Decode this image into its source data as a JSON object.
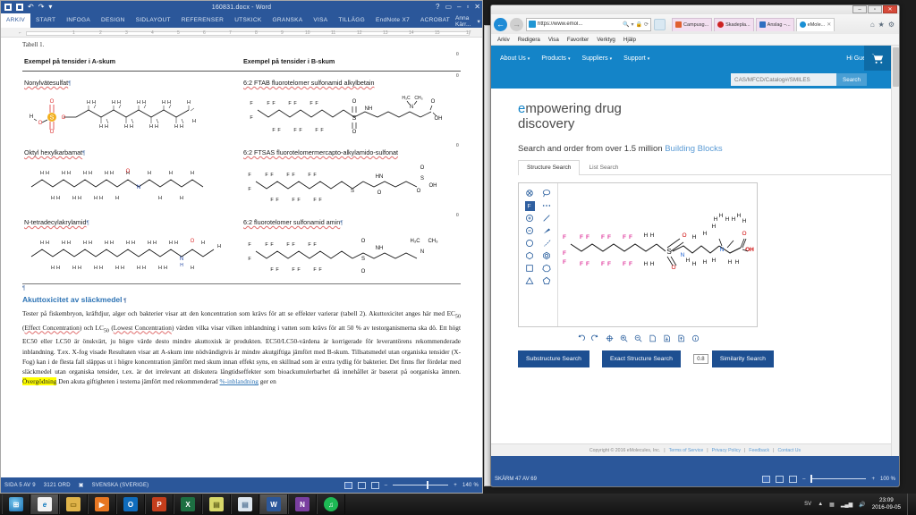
{
  "word": {
    "title": "160831.docx - Word",
    "qat": {
      "save": "save-icon",
      "undo": "↶",
      "redo": "↷",
      "more": "▾"
    },
    "window_controls": {
      "help": "?",
      "ribbon": "▭",
      "minimize": "–",
      "maximize": "▫",
      "close": "✕"
    },
    "tabs": [
      "ARKIV",
      "START",
      "INFOGA",
      "DESIGN",
      "SIDLAYOUT",
      "REFERENSER",
      "UTSKICK",
      "GRANSKA",
      "VISA",
      "TILLÄGG",
      "EndNote X7",
      "ACROBAT"
    ],
    "user": "Anna Kärr...",
    "ruler_marks": [
      "1",
      "2",
      "3",
      "4",
      "5",
      "6",
      "7",
      "8",
      "9",
      "10",
      "11",
      "12",
      "13",
      "14",
      "15",
      "17"
    ],
    "document": {
      "caption": "Tabell 1.",
      "table": {
        "headers": [
          "Exempel på tensider i A-skum",
          "Exempel på tensider i B-skum"
        ],
        "rows": [
          {
            "left": "Nonylvätesulfat",
            "right": "6:2 FTAB fluorotelomer sulfonamid alkylbetain"
          },
          {
            "left": "Oktyl hexylkarbamat",
            "right": "6:2 FTSAS fluorotelomermercapto-alkylamido-sulfonat"
          },
          {
            "left": "N-tetradecylakrylamid",
            "right": "6:2 fluorotelomer sulfonamid amin"
          }
        ]
      },
      "heading": "Akuttoxicitet av släckmedel",
      "body_parts": [
        {
          "t": "Tester på fiskembryon, kräftdjur, alger och bakterier visar att den koncentration som krävs för att se effekter varierar (tabell 2). Akuttoxicitet anges här med EC"
        },
        {
          "t": "50",
          "s": "sub"
        },
        {
          "t": " (",
          "s": "plain"
        },
        {
          "t": "Effect Concentration",
          "s": "sp"
        },
        {
          "t": ") och LC",
          "s": "plain"
        },
        {
          "t": "50",
          "s": "sub"
        },
        {
          "t": " (",
          "s": "plain"
        },
        {
          "t": "Lowest Concentration",
          "s": "sp"
        },
        {
          "t": ") värden vilka visar vilken inblandning i vatten som krävs för att 50 % av testorganismerna ska dö. Ett högt EC50 eller LC50 är önskvärt, ju högre värde desto mindre akuttoxisk är produkten. EC50/LC50-värdena är korrigerade för leverantörens rekommenderade inblandning. T.ex. X-fog visade Resultaten visar att A-skum inte nödvändigtvis är mindre akutgiftiga jämfört med B-skum. Tillsatsmedel utan organiska tensider (X-Fog) kan i de flesta fall släppas ut i högre koncentration jämfört med skum innan effekt syns, en skillnad som är extra tydlig för bakterier. Det finns fler fördelar med släckmedel utan organiska tensider, t.ex. är det irrelevant att diskutera långtidseffekter som bioackumulerbarhet då innehållet är baserat på oorganiska ämnen. ",
          "s": "plain"
        },
        {
          "t": "Övergödning",
          "s": "hl"
        },
        {
          "t": " Den akuta giftigheten i testerna jämfört med rekommenderad ",
          "s": "plain"
        },
        {
          "t": "%-inblandning",
          "s": "lnk"
        },
        {
          "t": " ger en",
          "s": "plain"
        }
      ]
    },
    "status": {
      "page": "SIDA 5 AV 9",
      "words": "3121 ORD",
      "proofing": "proofing-icon",
      "language": "SVENSKA (SVERIGE)",
      "zoom": "140 %"
    }
  },
  "behind_window": {
    "label": "Anslag"
  },
  "ie": {
    "window_controls": {
      "minimize": "–",
      "maximize": "▫",
      "close": "✕"
    },
    "address": {
      "url": "https://www.emol...",
      "search_icon": "search-icon",
      "lock_icon": "lock-icon",
      "refresh_icon": "refresh-icon"
    },
    "tabs": [
      {
        "label": "Campusg...",
        "color": "#e06030",
        "active": false
      },
      {
        "label": "Skadepla...",
        "color": "#cc2222",
        "active": false
      },
      {
        "label": "Anslag –...",
        "color": "#2f6fc0",
        "active": false
      },
      {
        "label": "eMole...",
        "color": "#1a8fd4",
        "active": true
      }
    ],
    "toolbar_icons": [
      "home-icon",
      "favorites-star-icon",
      "tools-gear-icon"
    ],
    "menu": [
      "Arkiv",
      "Redigera",
      "Visa",
      "Favoriter",
      "Verktyg",
      "Hjälp"
    ],
    "status": {
      "zoom": "100 %",
      "page": "SKÄRM 47 AV 69"
    }
  },
  "site": {
    "nav": [
      {
        "label": "About Us",
        "caret": "▾"
      },
      {
        "label": "Products",
        "caret": "▾"
      },
      {
        "label": "Suppliers",
        "caret": "▾"
      },
      {
        "label": "Support",
        "caret": "▾"
      }
    ],
    "account": "Hi Guest",
    "account_caret": "▾",
    "cart_icon": "shopping-cart-icon",
    "search": {
      "placeholder": "CAS/MFCD/Catalog#/SMILES",
      "value": "",
      "button": "Search"
    },
    "hero": {
      "line1_accent": "e",
      "line1_rest": "mpowering drug",
      "line2": "discovery"
    },
    "subtitle": {
      "text": "Search and order from over 1.5 million ",
      "link": "Building Blocks"
    },
    "tabs": [
      {
        "label": "Structure Search",
        "active": true
      },
      {
        "label": "List Search",
        "active": false
      }
    ],
    "editor": {
      "tools": [
        [
          "erase-atom-icon",
          "lasso-select-icon"
        ],
        [
          "fluorine-atom-tool-icon",
          "more-atoms-icon"
        ],
        [
          "add-charge-icon",
          "single-bond-icon"
        ],
        [
          "remove-charge-icon",
          "wedge-bond-icon"
        ],
        [
          "circle-tool-icon",
          "hash-bond-icon"
        ],
        [
          "hexagon-tool-icon",
          "aromatic-ring-icon"
        ],
        [
          "square-tool-icon",
          "heptagon-tool-icon"
        ],
        [
          "triangle-tool-icon",
          "pentagon-tool-icon"
        ]
      ],
      "selected_tool": "fluorine-atom-tool-icon",
      "bottom_tools": [
        "undo-icon",
        "redo-icon",
        "clean-structure-icon",
        "zoom-in-icon",
        "zoom-out-icon",
        "new-document-icon",
        "import-file-icon",
        "export-file-icon",
        "info-icon"
      ]
    },
    "buttons": {
      "substructure": "Substructure Search",
      "exact": "Exact Structure Search",
      "similarity_value": "0.8",
      "similarity": "Similarity Search"
    },
    "footer": {
      "copyright": "Copyright © 2016 eMolecules, Inc.",
      "links": [
        "Terms of Service",
        "Privacy Policy",
        "Feedback",
        "Contact Us"
      ]
    }
  },
  "taskbar": {
    "start_icon": "windows-start-icon",
    "items": [
      {
        "name": "internet-explorer",
        "glyph": "e",
        "color": "#1a7fc1",
        "active": true
      },
      {
        "name": "file-explorer",
        "glyph": "🗂",
        "color": "#e0b44a",
        "active": false
      },
      {
        "name": "media-player",
        "glyph": "▶",
        "color": "#e87722",
        "active": false
      },
      {
        "name": "outlook",
        "glyph": "O",
        "color": "#0f6cbd",
        "active": false
      },
      {
        "name": "powerpoint",
        "glyph": "P",
        "color": "#c43e1c",
        "active": false
      },
      {
        "name": "excel",
        "glyph": "X",
        "color": "#1d6f42",
        "active": false
      },
      {
        "name": "sticky-notes",
        "glyph": "▤",
        "color": "#d8d86a",
        "active": false
      },
      {
        "name": "document",
        "glyph": "▤",
        "color": "#dde6ef",
        "active": false
      },
      {
        "name": "word",
        "glyph": "W",
        "color": "#2b579a",
        "active": true
      },
      {
        "name": "onenote",
        "glyph": "N",
        "color": "#7a3fa0",
        "active": false
      },
      {
        "name": "spotify",
        "glyph": "♫",
        "color": "#1db954",
        "active": false
      }
    ],
    "tray": {
      "language": "SV",
      "chevron": "▲",
      "network_icon": "network-icon",
      "signal_icon": "signal-icon",
      "volume_icon": "volume-icon"
    },
    "clock": {
      "time": "23:09",
      "date": "2016-09-05"
    }
  }
}
